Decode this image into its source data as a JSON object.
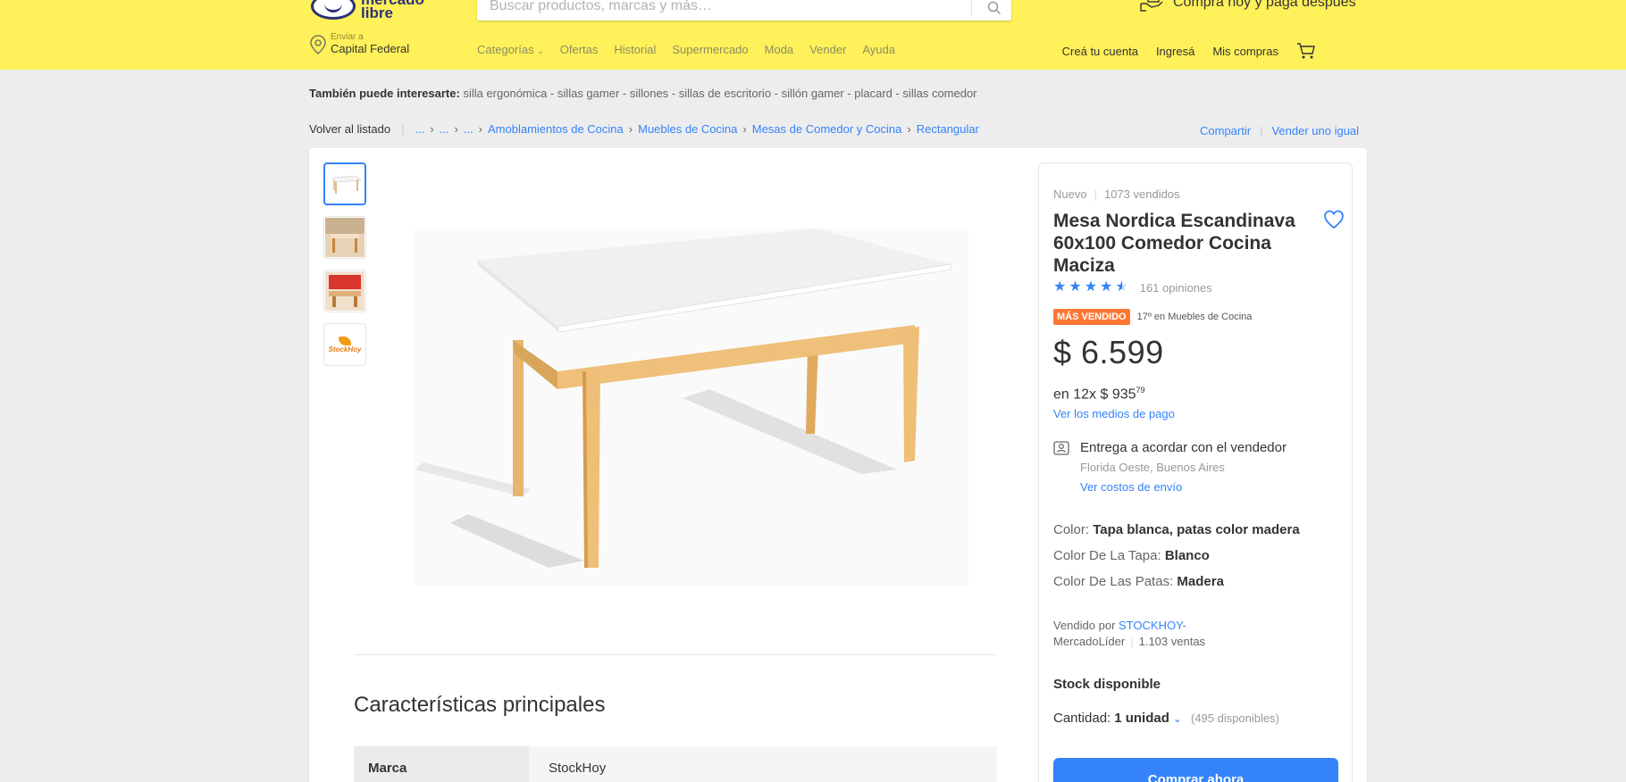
{
  "header": {
    "logo_text_line1": "mercado",
    "logo_text_line2": "libre",
    "search_placeholder": "Buscar productos, marcas y más…",
    "promo_text": "Comprá hoy y pagá después",
    "location_label": "Enviar a",
    "location_city": "Capital Federal",
    "nav": [
      "Categorías",
      "Ofertas",
      "Historial",
      "Supermercado",
      "Moda",
      "Vender",
      "Ayuda"
    ],
    "user_nav": {
      "create_account": "Creá tu cuenta",
      "login": "Ingresá",
      "purchases": "Mis compras"
    }
  },
  "suggestions": {
    "label": "También puede interesarte:",
    "items": "silla ergonómica - sillas gamer - sillones - sillas de escritorio - sillón gamer - placard - sillas comedor"
  },
  "breadcrumb": {
    "back": "Volver al listado",
    "ellipsis": "...",
    "items": [
      "Amoblamientos de Cocina",
      "Muebles de Cocina",
      "Mesas de Comedor y Cocina",
      "Rectangular"
    ]
  },
  "actions": {
    "share": "Compartir",
    "sell_similar": "Vender uno igual"
  },
  "product": {
    "condition": "Nuevo",
    "sold": "1073 vendidos",
    "title": "Mesa Nordica Escandinava 60x100 Comedor Cocina Maciza",
    "rating": 4.5,
    "reviews": "161 opiniones",
    "badge": "MÁS VENDIDO",
    "ranking": "17º en Muebles de Cocina",
    "price": "$ 6.599",
    "installments_prefix": "en 12x $ 935",
    "installments_cents": "79",
    "payment_link": "Ver los medios de pago",
    "delivery_title": "Entrega a acordar con el vendedor",
    "delivery_location": "Florida Oeste, Buenos Aires",
    "shipping_link": "Ver costos de envío",
    "attributes": [
      {
        "label": "Color: ",
        "value": "Tapa blanca, patas color madera"
      },
      {
        "label": "Color De La Tapa: ",
        "value": "Blanco"
      },
      {
        "label": "Color De Las Patas: ",
        "value": "Madera"
      }
    ],
    "seller_prefix": "Vendido por ",
    "seller_name": "STOCKHOY-",
    "seller_level": "MercadoLíder",
    "seller_sales": "1.103 ventas",
    "stock": "Stock disponible",
    "quantity_label": "Cantidad: ",
    "quantity_value": "1 unidad",
    "quantity_available": "(495 disponibles)",
    "buy_button": "Comprar ahora",
    "thumb_4_text": "StockHoy"
  },
  "features": {
    "title": "Características principales",
    "rows": [
      {
        "key": "Marca",
        "value": "StockHoy"
      }
    ]
  },
  "colors": {
    "header_yellow": "#fff159",
    "accent_blue": "#3483fa",
    "badge_orange": "#ff7733"
  }
}
